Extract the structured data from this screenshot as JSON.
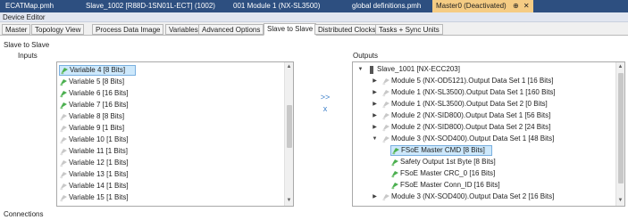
{
  "document_tabs": [
    {
      "label": "ECATMap.pmh",
      "active": false
    },
    {
      "label": "Slave_1002 [R88D-1SN01L-ECT] (1002)",
      "active": false
    },
    {
      "label": "001 Module 1 (NX-SL3500)",
      "active": false
    },
    {
      "label": "global definitions.pmh",
      "active": false
    },
    {
      "label": "Master0 (Deactivated)",
      "active": true
    }
  ],
  "active_tab_pin": "⊕",
  "active_tab_close": "✕",
  "editor_title": "Device Editor",
  "sub_tabs": [
    {
      "label": "Master",
      "active": false
    },
    {
      "label": "Topology View",
      "active": false
    },
    {
      "label": "Process Data Image",
      "active": false
    },
    {
      "label": "Variables",
      "active": false
    },
    {
      "label": "Advanced Options",
      "active": false
    },
    {
      "label": "Slave to Slave",
      "active": true
    },
    {
      "label": "Distributed Clocks",
      "active": false
    },
    {
      "label": "Tasks + Sync Units",
      "active": false
    }
  ],
  "section_title": "Slave to Slave",
  "inputs": {
    "label": "Inputs",
    "items": [
      {
        "text": "Variable 4 [8 Bits]",
        "selected": true,
        "icon": "green-variable-icon"
      },
      {
        "text": "Variable 5 [8 Bits]",
        "selected": false,
        "icon": "green-variable-icon"
      },
      {
        "text": "Variable 6 [16 Bits]",
        "selected": false,
        "icon": "green-variable-icon"
      },
      {
        "text": "Variable 7 [16 Bits]",
        "selected": false,
        "icon": "green-variable-icon"
      },
      {
        "text": "Variable 8 [8 Bits]",
        "selected": false,
        "icon": "grey-variable-icon"
      },
      {
        "text": "Variable 9 [1 Bits]",
        "selected": false,
        "icon": "grey-variable-icon"
      },
      {
        "text": "Variable 10 [1 Bits]",
        "selected": false,
        "icon": "grey-variable-icon"
      },
      {
        "text": "Variable 11 [1 Bits]",
        "selected": false,
        "icon": "grey-variable-icon"
      },
      {
        "text": "Variable 12 [1 Bits]",
        "selected": false,
        "icon": "grey-variable-icon"
      },
      {
        "text": "Variable 13 [1 Bits]",
        "selected": false,
        "icon": "grey-variable-icon"
      },
      {
        "text": "Variable 14 [1 Bits]",
        "selected": false,
        "icon": "grey-variable-icon"
      },
      {
        "text": "Variable 15 [1 Bits]",
        "selected": false,
        "icon": "grey-variable-icon"
      }
    ]
  },
  "middle_controls": {
    "assign": ">>",
    "remove": "x"
  },
  "outputs": {
    "label": "Outputs",
    "items": [
      {
        "text": "Slave_1001 [NX-ECC203]",
        "expander": "expanded",
        "icon": "device-icon",
        "indent": 0,
        "selected": false
      },
      {
        "text": "Module 5 (NX-OD5121).Output Data Set 1 [16 Bits]",
        "expander": "collapsed",
        "icon": "grey-variable-icon",
        "indent": 1,
        "selected": false
      },
      {
        "text": "Module 1 (NX-SL3500).Output Data Set 1 [160 Bits]",
        "expander": "collapsed",
        "icon": "grey-variable-icon",
        "indent": 1,
        "selected": false
      },
      {
        "text": "Module 1 (NX-SL3500).Output Data Set 2 [0 Bits]",
        "expander": "collapsed",
        "icon": "grey-variable-icon",
        "indent": 1,
        "selected": false
      },
      {
        "text": "Module 2 (NX-SID800).Output Data Set 1 [56 Bits]",
        "expander": "collapsed",
        "icon": "grey-variable-icon",
        "indent": 1,
        "selected": false
      },
      {
        "text": "Module 2 (NX-SID800).Output Data Set 2 [24 Bits]",
        "expander": "collapsed",
        "icon": "grey-variable-icon",
        "indent": 1,
        "selected": false
      },
      {
        "text": "Module 3 (NX-SOD400).Output Data Set 1 [48 Bits]",
        "expander": "expanded",
        "icon": "grey-variable-icon",
        "indent": 1,
        "selected": false
      },
      {
        "text": "FSoE Master CMD [8 Bits]",
        "expander": "none",
        "icon": "green-variable-icon",
        "indent": 2,
        "selected": true
      },
      {
        "text": "Safety Output 1st Byte [8 Bits]",
        "expander": "none",
        "icon": "green-variable-icon",
        "indent": 2,
        "selected": false
      },
      {
        "text": "FSoE Master CRC_0 [16 Bits]",
        "expander": "none",
        "icon": "green-variable-icon",
        "indent": 2,
        "selected": false
      },
      {
        "text": "FSoE Master Conn_ID [16 Bits]",
        "expander": "none",
        "icon": "green-variable-icon",
        "indent": 2,
        "selected": false
      },
      {
        "text": "Module 3 (NX-SOD400).Output Data Set 2 [16 Bits]",
        "expander": "collapsed",
        "icon": "grey-variable-icon",
        "indent": 1,
        "selected": false
      }
    ]
  },
  "connections_label": "Connections",
  "colors": {
    "title_bar": "#2d4f80",
    "active_tab": "#f5cc84",
    "selection": "#cde8fb",
    "variable_green": "#4caf50",
    "device_dark": "#555555"
  }
}
